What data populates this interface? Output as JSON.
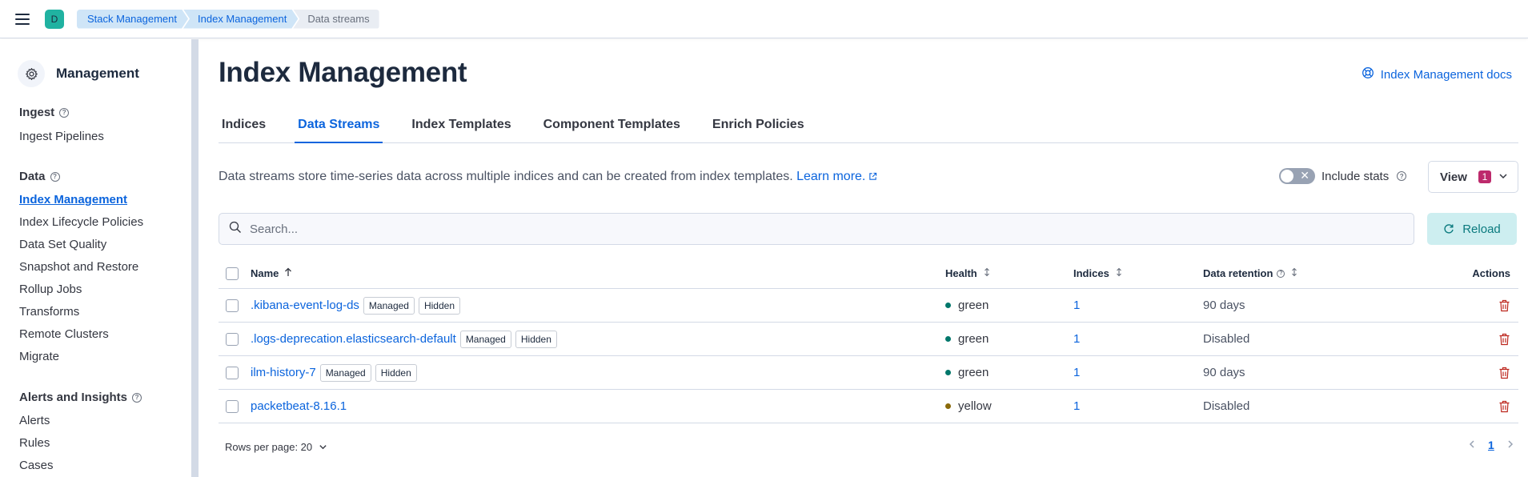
{
  "topbar": {
    "space_initial": "D",
    "breadcrumbs": [
      "Stack Management",
      "Index Management",
      "Data streams"
    ]
  },
  "sidebar": {
    "title": "Management",
    "groups": [
      {
        "title": "Ingest",
        "items": [
          "Ingest Pipelines"
        ]
      },
      {
        "title": "Data",
        "items": [
          "Index Management",
          "Index Lifecycle Policies",
          "Data Set Quality",
          "Snapshot and Restore",
          "Rollup Jobs",
          "Transforms",
          "Remote Clusters",
          "Migrate"
        ]
      },
      {
        "title": "Alerts and Insights",
        "items": [
          "Alerts",
          "Rules",
          "Cases"
        ]
      }
    ],
    "active_item": "Index Management"
  },
  "main": {
    "title": "Index Management",
    "docs_link": "Index Management docs",
    "tabs": [
      "Indices",
      "Data Streams",
      "Index Templates",
      "Component Templates",
      "Enrich Policies"
    ],
    "active_tab": "Data Streams",
    "description": "Data streams store time-series data across multiple indices and can be created from index templates.",
    "learn_more": "Learn more.",
    "include_stats_label": "Include stats",
    "view_label": "View",
    "view_count": "1",
    "search_placeholder": "Search...",
    "reload_label": "Reload"
  },
  "table": {
    "columns": {
      "name": "Name",
      "health": "Health",
      "indices": "Indices",
      "retention": "Data retention",
      "actions": "Actions"
    },
    "rows": [
      {
        "name": ".kibana-event-log-ds",
        "badges": [
          "Managed",
          "Hidden"
        ],
        "health": "green",
        "indices": "1",
        "retention": "90 days"
      },
      {
        "name": ".logs-deprecation.elasticsearch-default",
        "badges": [
          "Managed",
          "Hidden"
        ],
        "health": "green",
        "indices": "1",
        "retention": "Disabled"
      },
      {
        "name": "ilm-history-7",
        "badges": [
          "Managed",
          "Hidden"
        ],
        "health": "green",
        "indices": "1",
        "retention": "90 days"
      },
      {
        "name": "packetbeat-8.16.1",
        "badges": [],
        "health": "yellow",
        "indices": "1",
        "retention": "Disabled"
      }
    ],
    "health_colors": {
      "green": "#00776b",
      "yellow": "#8a6a0a"
    }
  },
  "pagination": {
    "rows_per_page": "Rows per page: 20",
    "current_page": "1"
  }
}
